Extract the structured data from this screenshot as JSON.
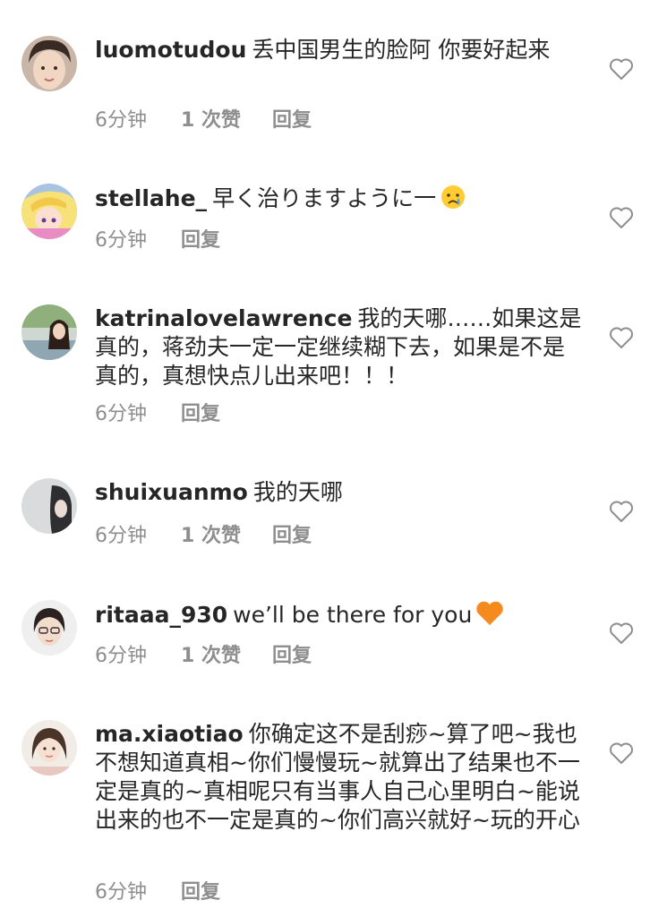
{
  "comments": [
    {
      "username": "luomotudou",
      "text": "丢中国男生的脸阿 你要好起来",
      "time": "6分钟",
      "likes": "1 次赞",
      "reply": "回复",
      "emoji": ""
    },
    {
      "username": "stellahe_",
      "text": "早く治りますように一",
      "time": "6分钟",
      "likes": "",
      "reply": "回复",
      "emoji": "crying-face"
    },
    {
      "username": "katrinalovelawrence",
      "text": "我的天哪……如果这是真的，蒋劲夫一定一定继续糊下去，如果是不是真的，真想快点儿出来吧！！！",
      "time": "6分钟",
      "likes": "",
      "reply": "回复",
      "emoji": ""
    },
    {
      "username": "shuixuanmo",
      "text": "我的天哪",
      "time": "6分钟",
      "likes": "1 次赞",
      "reply": "回复",
      "emoji": ""
    },
    {
      "username": "ritaaa_930",
      "text": "we’ll be there for you",
      "time": "6分钟",
      "likes": "1 次赞",
      "reply": "回复",
      "emoji": "orange-heart"
    },
    {
      "username": "ma.xiaotiao",
      "text": "你确定这不是刮痧~算了吧~我也不想知道真相~你们慢慢玩~就算出了结果也不一定是真的~真相呢只有当事人自己心里明白~能说出来的也不一定是真的~你们高兴就好~玩的开心",
      "time": "6分钟",
      "likes": "",
      "reply": "回复",
      "emoji": ""
    }
  ],
  "icons": {
    "like": "heart-outline-icon"
  },
  "colors": {
    "text": "#262626",
    "meta": "#8e8e8e",
    "heart_stroke": "#8e8e8e",
    "orange_heart": "#f58a1f"
  }
}
